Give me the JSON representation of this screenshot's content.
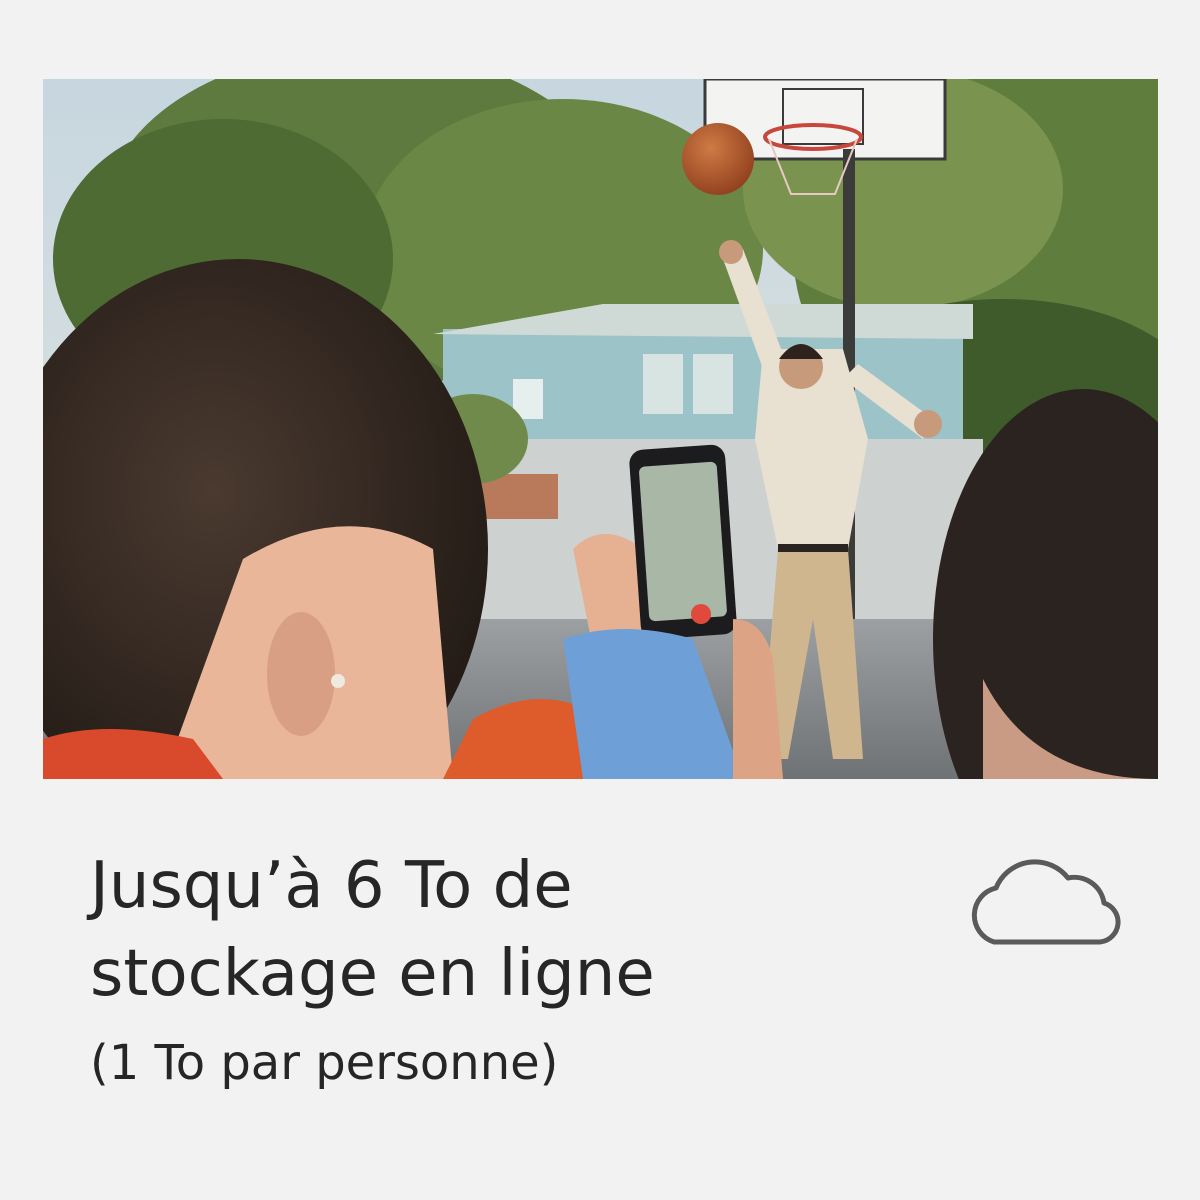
{
  "headline": {
    "line1": "Jusqu’à 6 To de",
    "line2": "stockage en ligne"
  },
  "subline": "(1 To par personne)",
  "icons": {
    "storage": "cloud-icon"
  },
  "colors": {
    "background": "#f2f2f2",
    "text": "#262626",
    "icon_stroke": "#5a5a5a"
  }
}
